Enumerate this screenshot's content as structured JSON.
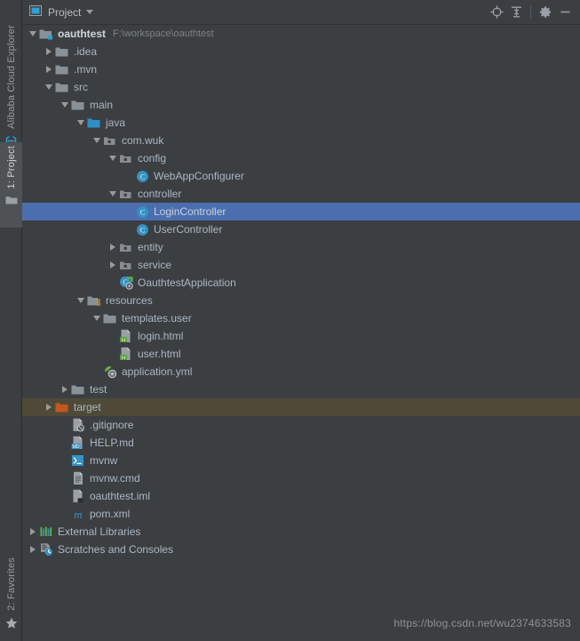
{
  "window": {
    "title": "Project",
    "tool_icon": "project-view-icon",
    "dropdown_icon": "chevron-down-icon"
  },
  "toolbar": {
    "buttons": [
      {
        "name": "locate-icon",
        "tooltip": "Select Opened File"
      },
      {
        "name": "collapse-all-icon",
        "tooltip": "Collapse All"
      },
      {
        "name": "gear-icon",
        "tooltip": "Settings"
      },
      {
        "name": "minimize-icon",
        "tooltip": "Hide"
      }
    ]
  },
  "sidebar": {
    "tabs": [
      {
        "label": "Alibaba Cloud Explorer",
        "icon": "alibaba-cloud-icon",
        "active": false
      },
      {
        "label": "1: Project",
        "icon": "folder-icon",
        "active": true
      },
      {
        "label": "2: Favorites",
        "icon": "star-icon",
        "active": false
      }
    ]
  },
  "colors": {
    "background": "#3c3f41",
    "selection": "#4b6eaf",
    "marked_row": "#4f4a38",
    "text": "#a9b7c6",
    "muted_text": "#7b8186",
    "folder": "#8a9196",
    "source_folder": "#3592c4",
    "target_folder": "#cc5c20",
    "class_icon": "#389fd6",
    "html_badge": "#5c9b41",
    "md_badge": "#3592c4"
  },
  "tree": [
    {
      "depth": 0,
      "label": "oauthtest",
      "sub": "F:\\workspace\\oauthtest",
      "icon": "module-folder-icon",
      "state": "open",
      "bold": true
    },
    {
      "depth": 1,
      "label": ".idea",
      "sub": "",
      "icon": "folder-icon",
      "state": "closed",
      "bold": false
    },
    {
      "depth": 1,
      "label": ".mvn",
      "sub": "",
      "icon": "folder-icon",
      "state": "closed",
      "bold": false
    },
    {
      "depth": 1,
      "label": "src",
      "sub": "",
      "icon": "folder-icon",
      "state": "open",
      "bold": false
    },
    {
      "depth": 2,
      "label": "main",
      "sub": "",
      "icon": "folder-icon",
      "state": "open",
      "bold": false
    },
    {
      "depth": 3,
      "label": "java",
      "sub": "",
      "icon": "source-folder-icon",
      "state": "open",
      "bold": false
    },
    {
      "depth": 4,
      "label": "com.wuk",
      "sub": "",
      "icon": "package-icon",
      "state": "open",
      "bold": false
    },
    {
      "depth": 5,
      "label": "config",
      "sub": "",
      "icon": "package-icon",
      "state": "open",
      "bold": false
    },
    {
      "depth": 6,
      "label": "WebAppConfigurer",
      "sub": "",
      "icon": "class-icon",
      "state": "leaf",
      "bold": false
    },
    {
      "depth": 5,
      "label": "controller",
      "sub": "",
      "icon": "package-icon",
      "state": "open",
      "bold": false
    },
    {
      "depth": 6,
      "label": "LoginController",
      "sub": "",
      "icon": "class-icon",
      "state": "leaf",
      "bold": false,
      "selected": true
    },
    {
      "depth": 6,
      "label": "UserController",
      "sub": "",
      "icon": "class-icon",
      "state": "leaf",
      "bold": false
    },
    {
      "depth": 5,
      "label": "entity",
      "sub": "",
      "icon": "package-icon",
      "state": "closed",
      "bold": false
    },
    {
      "depth": 5,
      "label": "service",
      "sub": "",
      "icon": "package-icon",
      "state": "closed",
      "bold": false
    },
    {
      "depth": 5,
      "label": "OauthtestApplication",
      "sub": "",
      "icon": "runnable-class-icon",
      "state": "leaf",
      "bold": false
    },
    {
      "depth": 3,
      "label": "resources",
      "sub": "",
      "icon": "resource-folder-icon",
      "state": "open",
      "bold": false
    },
    {
      "depth": 4,
      "label": "templates.user",
      "sub": "",
      "icon": "folder-icon",
      "state": "open",
      "bold": false
    },
    {
      "depth": 5,
      "label": "login.html",
      "sub": "",
      "icon": "html-file-icon",
      "state": "leaf",
      "bold": false
    },
    {
      "depth": 5,
      "label": "user.html",
      "sub": "",
      "icon": "html-file-icon",
      "state": "leaf",
      "bold": false
    },
    {
      "depth": 4,
      "label": "application.yml",
      "sub": "",
      "icon": "yml-file-icon",
      "state": "leaf",
      "bold": false
    },
    {
      "depth": 2,
      "label": "test",
      "sub": "",
      "icon": "folder-icon",
      "state": "closed",
      "bold": false
    },
    {
      "depth": 1,
      "label": "target",
      "sub": "",
      "icon": "target-folder-icon",
      "state": "closed",
      "bold": false,
      "marked": true
    },
    {
      "depth": 2,
      "label": ".gitignore",
      "sub": "",
      "icon": "gitignore-file-icon",
      "state": "leaf",
      "bold": false
    },
    {
      "depth": 2,
      "label": "HELP.md",
      "sub": "",
      "icon": "md-file-icon",
      "state": "leaf",
      "bold": false
    },
    {
      "depth": 2,
      "label": "mvnw",
      "sub": "",
      "icon": "shell-file-icon",
      "state": "leaf",
      "bold": false
    },
    {
      "depth": 2,
      "label": "mvnw.cmd",
      "sub": "",
      "icon": "text-file-icon",
      "state": "leaf",
      "bold": false
    },
    {
      "depth": 2,
      "label": "oauthtest.iml",
      "sub": "",
      "icon": "iml-file-icon",
      "state": "leaf",
      "bold": false
    },
    {
      "depth": 2,
      "label": "pom.xml",
      "sub": "",
      "icon": "maven-file-icon",
      "state": "leaf",
      "bold": false
    },
    {
      "depth": 0,
      "label": "External Libraries",
      "sub": "",
      "icon": "libraries-icon",
      "state": "closed",
      "bold": false
    },
    {
      "depth": 0,
      "label": "Scratches and Consoles",
      "sub": "",
      "icon": "scratches-icon",
      "state": "closed",
      "bold": false
    }
  ],
  "watermark": {
    "text": "https://blog.csdn.net/wu2374633583"
  }
}
